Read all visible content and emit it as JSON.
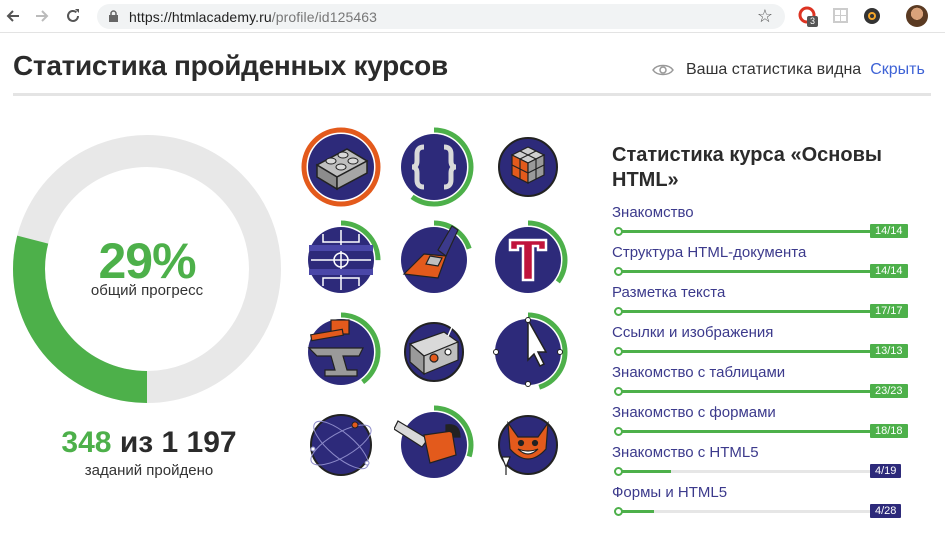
{
  "browser": {
    "url_host": "https://htmlacademy.ru",
    "url_path": "/profile/id125463",
    "extension_badge": "3"
  },
  "header": {
    "title": "Статистика пройденных курсов",
    "visibility_text": "Ваша статистика видна",
    "hide_link": "Скрыть"
  },
  "progress": {
    "percent_label": "29%",
    "percent_value": 0.29,
    "caption": "общий прогресс",
    "tasks_done": "348",
    "tasks_of": "из",
    "tasks_total": "1 197",
    "tasks_caption": "заданий пройдено",
    "ring_color": "#4db04a",
    "track_color": "#e8e8e8"
  },
  "course": {
    "title": "Статистика курса «Основы HTML»",
    "chapters": [
      {
        "name": "Знакомство",
        "count": "14/14",
        "progress": 1.0
      },
      {
        "name": "Структура HTML-документа",
        "count": "14/14",
        "progress": 1.0
      },
      {
        "name": "Разметка текста",
        "count": "17/17",
        "progress": 1.0
      },
      {
        "name": "Ссылки и изображения",
        "count": "13/13",
        "progress": 1.0
      },
      {
        "name": "Знакомство с таблицами",
        "count": "23/23",
        "progress": 1.0
      },
      {
        "name": "Знакомство с формами",
        "count": "18/18",
        "progress": 1.0
      },
      {
        "name": "Знакомство с HTML5",
        "count": "4/19",
        "progress": 0.21
      },
      {
        "name": "Формы и HTML5",
        "count": "4/28",
        "progress": 0.14
      }
    ],
    "complete_color": "#4db04a",
    "incomplete_color": "#2d2a7a"
  },
  "badges": [
    {
      "icon": "lego-brick-icon",
      "progress": 1.0,
      "color": "#e35a1c"
    },
    {
      "icon": "code-braces-icon",
      "progress": 0.6,
      "color": "#4db04a"
    },
    {
      "icon": "cube-icon",
      "progress": 0,
      "color": "#4db04a"
    },
    {
      "icon": "sports-field-icon",
      "progress": 0.25,
      "color": "#4db04a"
    },
    {
      "icon": "paintbrush-icon",
      "progress": 0.2,
      "color": "#4db04a"
    },
    {
      "icon": "typography-icon",
      "progress": 0.35,
      "color": "#4db04a"
    },
    {
      "icon": "anvil-icon",
      "progress": 0.4,
      "color": "#4db04a"
    },
    {
      "icon": "control-box-icon",
      "progress": 0,
      "color": "#4db04a"
    },
    {
      "icon": "cursor-icon",
      "progress": 0.45,
      "color": "#4db04a"
    },
    {
      "icon": "orbit-icon",
      "progress": 0,
      "color": "#4db04a"
    },
    {
      "icon": "chainsaw-icon",
      "progress": 0.3,
      "color": "#4db04a"
    },
    {
      "icon": "fox-icon",
      "progress": 0,
      "color": "#4db04a"
    }
  ]
}
